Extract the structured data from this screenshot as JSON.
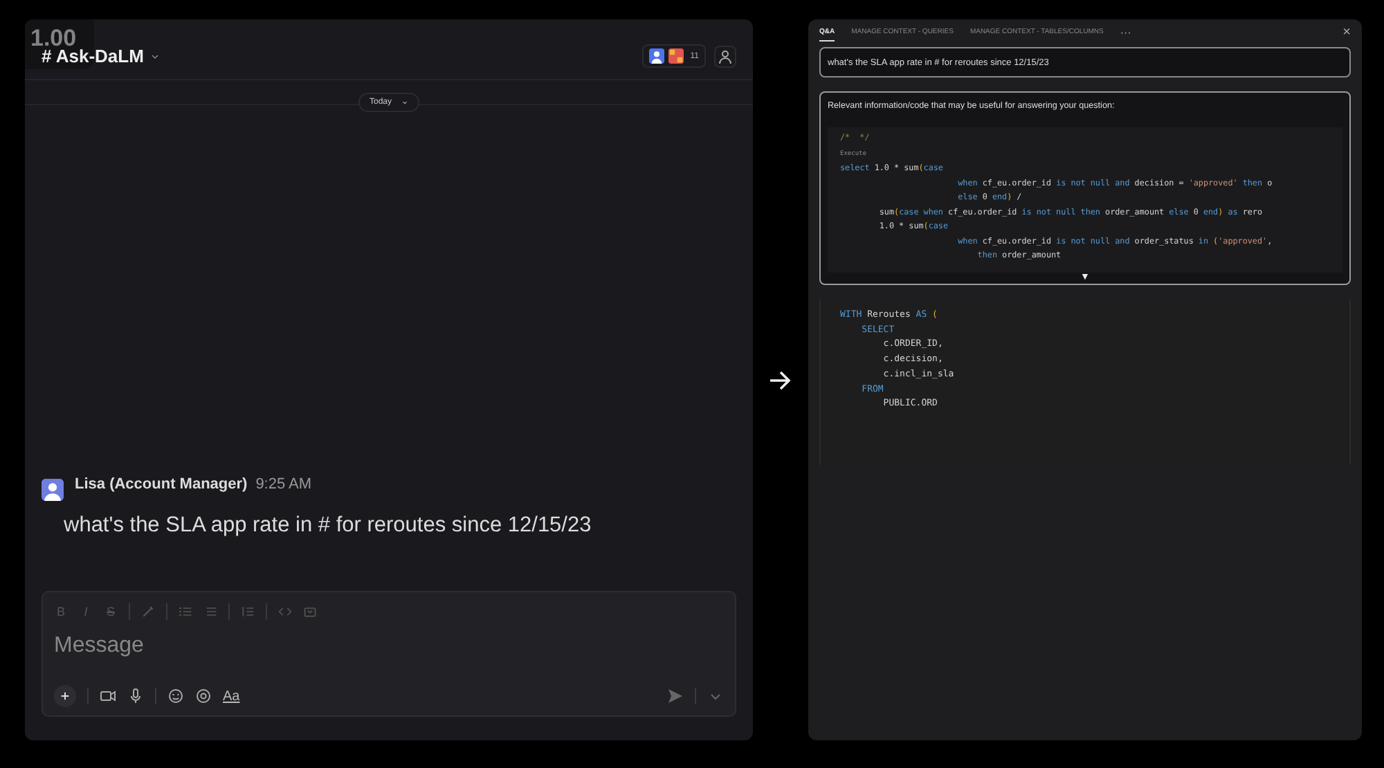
{
  "speed_badge": "1.00",
  "chat": {
    "channel": "# Ask-DaLM",
    "member_count": "11",
    "date_divider": "Today",
    "messages": [
      {
        "author": "Lisa (Account Manager)",
        "time": "9:25 AM",
        "text": "what's the SLA app rate in # for reroutes since 12/15/23"
      }
    ],
    "composer": {
      "format_buttons": [
        "B",
        "I",
        "S"
      ],
      "placeholder": "Message",
      "text_format_toggle": "Aa"
    }
  },
  "assistant": {
    "tabs": [
      {
        "label": "Q&A",
        "selected": true
      },
      {
        "label": "MANAGE CONTEXT - QUERIES",
        "selected": false
      },
      {
        "label": "MANAGE CONTEXT - TABLES/COLUMNS",
        "selected": false
      }
    ],
    "more": "···",
    "close": "×",
    "question": "what's the SLA app rate in # for reroutes since 12/15/23",
    "context": {
      "heading": "Relevant information/code that may be useful for answering your question:",
      "code": [
        [
          {
            "kind": "comment",
            "text": "/*  */"
          }
        ],
        [
          {
            "kind": "dim",
            "text": "Execute"
          }
        ],
        [
          {
            "kind": "kw",
            "text": "select"
          },
          {
            "kind": "plain",
            "text": " 1.0 * sum"
          },
          {
            "kind": "paren",
            "text": "("
          },
          {
            "kind": "kw",
            "text": "case"
          }
        ],
        [
          {
            "kind": "kw",
            "text": "                        when"
          },
          {
            "kind": "plain",
            "text": " cf_eu.order_id "
          },
          {
            "kind": "kw",
            "text": "is not null and"
          },
          {
            "kind": "plain",
            "text": " decision = "
          },
          {
            "kind": "str",
            "text": "'approved'"
          },
          {
            "kind": "kw",
            "text": " then"
          },
          {
            "kind": "plain",
            "text": " o"
          }
        ],
        [
          {
            "kind": "kw",
            "text": "                        else"
          },
          {
            "kind": "plain",
            "text": " 0 "
          },
          {
            "kind": "kw",
            "text": "end"
          },
          {
            "kind": "paren",
            "text": ")"
          },
          {
            "kind": "plain",
            "text": " /"
          }
        ],
        [
          {
            "kind": "plain",
            "text": "        sum"
          },
          {
            "kind": "paren",
            "text": "("
          },
          {
            "kind": "kw",
            "text": "case when"
          },
          {
            "kind": "plain",
            "text": " cf_eu.order_id "
          },
          {
            "kind": "kw",
            "text": "is not null then"
          },
          {
            "kind": "plain",
            "text": " order_amount "
          },
          {
            "kind": "kw",
            "text": "else"
          },
          {
            "kind": "plain",
            "text": " 0 "
          },
          {
            "kind": "kw",
            "text": "end"
          },
          {
            "kind": "paren",
            "text": ")"
          },
          {
            "kind": "kw",
            "text": " as"
          },
          {
            "kind": "plain",
            "text": " rero"
          }
        ],
        [
          {
            "kind": "plain",
            "text": "        1.0 * sum"
          },
          {
            "kind": "paren",
            "text": "("
          },
          {
            "kind": "kw",
            "text": "case"
          }
        ],
        [
          {
            "kind": "kw",
            "text": "                        when"
          },
          {
            "kind": "plain",
            "text": " cf_eu.order_id "
          },
          {
            "kind": "kw",
            "text": "is not null and"
          },
          {
            "kind": "plain",
            "text": " order_status "
          },
          {
            "kind": "kw",
            "text": "in"
          },
          {
            "kind": "paren",
            "text": " ("
          },
          {
            "kind": "str",
            "text": "'approved'"
          },
          {
            "kind": "plain",
            "text": ","
          }
        ],
        [
          {
            "kind": "kw",
            "text": "                            then"
          },
          {
            "kind": "plain",
            "text": " order_amount"
          }
        ]
      ],
      "expand": "▼"
    },
    "editor": [
      [
        {
          "kind": "kw",
          "text": "WITH"
        },
        {
          "kind": "plain",
          "text": " Reroutes "
        },
        {
          "kind": "kw",
          "text": "AS"
        },
        {
          "kind": "paren",
          "text": " ("
        }
      ],
      [
        {
          "kind": "kw",
          "text": "    SELECT"
        }
      ],
      [
        {
          "kind": "plain",
          "text": "        c.ORDER_ID,"
        }
      ],
      [
        {
          "kind": "plain",
          "text": "        c.decision,"
        }
      ],
      [
        {
          "kind": "plain",
          "text": "        c.incl_in_sla"
        }
      ],
      [
        {
          "kind": "kw",
          "text": "    FROM"
        }
      ],
      [
        {
          "kind": "plain",
          "text": "        PUBLIC.ORD"
        }
      ]
    ]
  }
}
